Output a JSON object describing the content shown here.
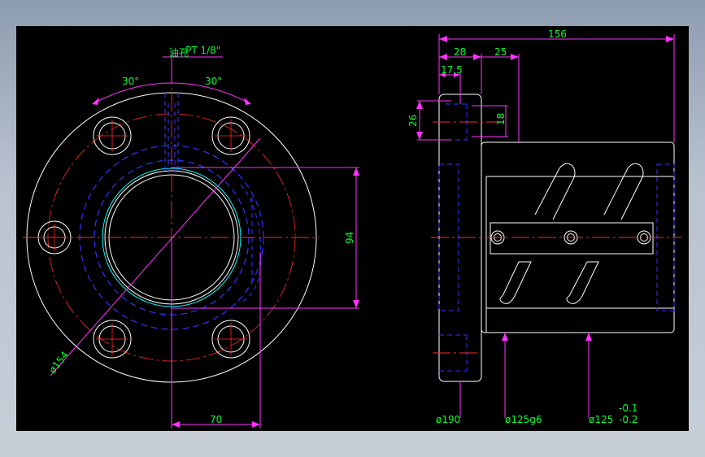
{
  "colors": {
    "background": "#000000",
    "outline": "#ffffff",
    "centerline": "#ff2a2a",
    "dimension": "#ff33ff",
    "dim_text": "#00ff33",
    "hidden": "#3333ff",
    "cyan": "#00ffff"
  },
  "front_view": {
    "oil_hole_label": "油孔",
    "thread_label": "PT 1/8\"",
    "angle_left": "30°",
    "angle_right": "30°",
    "dia_label": "ø154",
    "height_label": "94",
    "width_label": "70"
  },
  "side_view": {
    "total_length": "156",
    "flange_width": "28",
    "offset_25": "25",
    "dim_17_5": "17.5",
    "dim_26": "26",
    "dim_18": "18",
    "dia_flange": "ø190",
    "dia_body": "ø125g6",
    "dia_body2": "ø125",
    "tol_upper": "-0.1",
    "tol_lower": "-0.2"
  }
}
